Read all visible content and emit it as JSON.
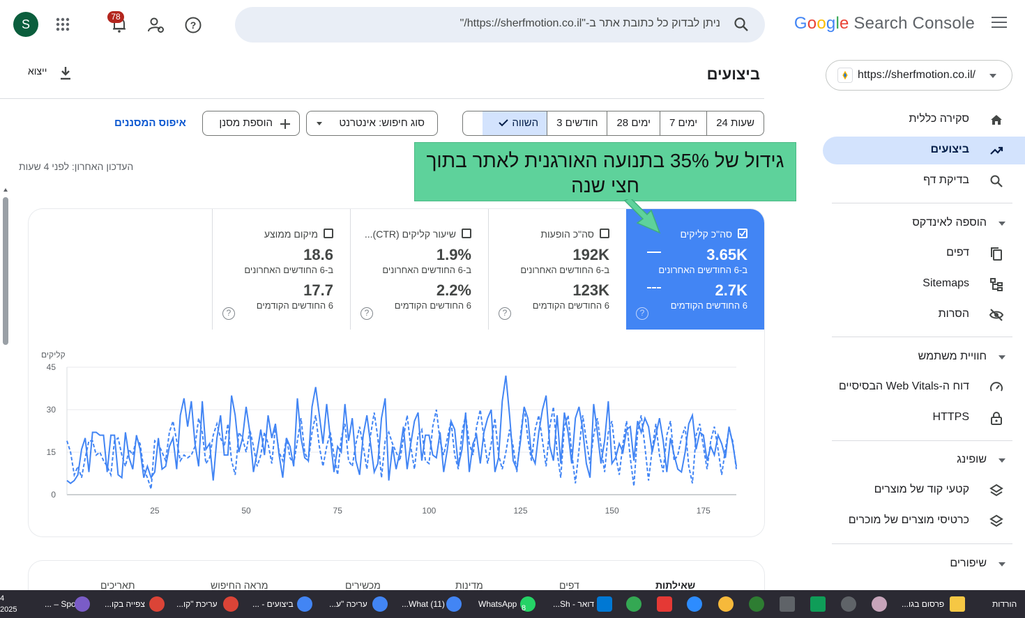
{
  "header": {
    "logo_google": "Google",
    "logo_rest": "Search Console",
    "search_placeholder": "ניתן לבדוק כל כתובת אתר ב-\"https://sherfmotion.co.il/\"",
    "avatar_letter": "S",
    "notification_count": "78"
  },
  "sidebar": {
    "property_url": "https://sherfmotion.co.il/",
    "items": [
      {
        "label": "סקירה כללית",
        "icon": "home-icon"
      },
      {
        "label": "ביצועים",
        "icon": "trending-up-icon",
        "active": true
      },
      {
        "label": "בדיקת דף",
        "icon": "search-icon"
      }
    ],
    "sections": [
      {
        "label": "הוספה לאינדקס",
        "items": [
          {
            "label": "דפים",
            "icon": "pages-icon"
          },
          {
            "label": "Sitemaps",
            "icon": "sitemap-icon"
          },
          {
            "label": "הסרות",
            "icon": "visibility-off-icon"
          }
        ]
      },
      {
        "label": "חוויית משתמש",
        "items": [
          {
            "label": "דוח ה-Web Vitals הבסיסיים",
            "icon": "speed-icon"
          },
          {
            "label": "HTTPS",
            "icon": "lock-icon"
          }
        ]
      },
      {
        "label": "שופינג",
        "items": [
          {
            "label": "קטעי קוד של מוצרים",
            "icon": "layers-icon"
          },
          {
            "label": "כרטיסי מוצרים של מוכרים",
            "icon": "layers-icon"
          }
        ]
      },
      {
        "label": "שיפורים",
        "items": []
      }
    ]
  },
  "main": {
    "title": "ביצועים",
    "export_label": "ייצוא",
    "date_ranges": [
      "24 שעות",
      "7 ימים",
      "28 ימים",
      "3 חודשים",
      "השווה"
    ],
    "date_range_selected": "השווה",
    "search_type_chip": "סוג חיפוש: אינטרנט",
    "add_filter_label": "הוספת מסנן",
    "reset_filters_label": "איפוס המסננים",
    "last_updated": "העדכון האחרון: לפני 4 שעות",
    "annotation": "גידול של 35% בתנועה האורגנית לאתר בתוך חצי שנה",
    "metrics": [
      {
        "label": "סה\"כ קליקים",
        "checked": true,
        "value_current": "3.65K",
        "label_current": "ב-6 החודשים האחרונים",
        "value_previous": "2.7K",
        "label_previous": "6 החודשים הקודמים",
        "color": "#4285f4"
      },
      {
        "label": "סה\"כ הופעות",
        "checked": false,
        "value_current": "192K",
        "label_current": "ב-6 החודשים האחרונים",
        "value_previous": "123K",
        "label_previous": "6 החודשים הקודמים"
      },
      {
        "label": "שיעור קליקים (CTR)...",
        "checked": false,
        "value_current": "1.9%",
        "label_current": "ב-6 החודשים האחרונים",
        "value_previous": "2.2%",
        "label_previous": "6 החודשים הקודמים"
      },
      {
        "label": "מיקום ממוצע",
        "checked": false,
        "value_current": "18.6",
        "label_current": "ב-6 החודשים האחרונים",
        "value_previous": "17.7",
        "label_previous": "6 החודשים הקודמים"
      }
    ],
    "bottom_tabs": [
      "שאילתות",
      "דפים",
      "מדינות",
      "מכשירים",
      "מראה החיפוש",
      "תאריכים"
    ]
  },
  "chart_data": {
    "type": "line",
    "ylabel": "קליקים",
    "ylim": [
      0,
      45
    ],
    "yticks": [
      0,
      15,
      30,
      45
    ],
    "xlim": [
      1,
      184
    ],
    "xticks": [
      25,
      50,
      75,
      100,
      125,
      150,
      175
    ],
    "grid": true,
    "color": "#4285f4",
    "series": [
      {
        "style": "solid",
        "values": [
          5,
          4,
          5,
          7,
          16,
          20,
          8,
          22,
          22,
          21,
          21,
          8,
          21,
          21,
          7,
          6,
          22,
          13,
          9,
          21,
          16,
          6,
          10,
          6,
          8,
          20,
          9,
          10,
          17,
          20,
          9,
          28,
          34,
          24,
          33,
          18,
          10,
          33,
          16,
          18,
          5,
          20,
          28,
          14,
          14,
          35,
          28,
          15,
          20,
          31,
          22,
          8,
          15,
          23,
          14,
          28,
          20,
          25,
          14,
          6,
          20,
          17,
          10,
          34,
          20,
          13,
          12,
          31,
          38,
          28,
          18,
          32,
          20,
          8,
          17,
          15,
          32,
          19,
          27,
          12,
          7,
          21,
          28,
          18,
          8,
          11,
          27,
          34,
          5,
          17,
          9,
          15,
          24,
          9,
          18,
          26,
          29,
          12,
          21,
          21,
          14,
          13,
          22,
          8,
          16,
          26,
          23,
          10,
          16,
          29,
          8,
          18,
          21,
          11,
          22,
          27,
          30,
          8,
          13,
          33,
          42,
          28,
          12,
          9,
          19,
          31,
          27,
          14,
          11,
          22,
          30,
          35,
          17,
          12,
          28,
          11,
          29,
          22,
          11,
          27,
          31,
          23,
          11,
          6,
          32,
          22,
          11,
          19,
          33,
          11,
          13,
          18,
          15,
          23,
          24,
          12,
          26,
          22,
          27,
          24,
          15,
          21,
          27,
          19,
          8,
          20,
          14,
          9,
          8,
          15,
          25,
          28,
          16,
          22,
          21,
          12,
          17,
          14,
          21,
          18,
          13,
          24,
          18,
          10
        ]
      },
      {
        "style": "dashed",
        "values": [
          19,
          15,
          7,
          10,
          6,
          13,
          19,
          19,
          14,
          15,
          12,
          10,
          7,
          19,
          20,
          14,
          10,
          16,
          14,
          20,
          18,
          9,
          6,
          2,
          19,
          18,
          15,
          12,
          22,
          26,
          19,
          12,
          14,
          13,
          14,
          17,
          27,
          22,
          11,
          13,
          21,
          25,
          20,
          17,
          25,
          12,
          7,
          22,
          20,
          15,
          23,
          17,
          10,
          14,
          22,
          18,
          11,
          24,
          15,
          12,
          20,
          13,
          11,
          19,
          27,
          15,
          12,
          22,
          28,
          17,
          10,
          17,
          22,
          14,
          7,
          20,
          25,
          12,
          10,
          18,
          24,
          17,
          9,
          21,
          29,
          20,
          6,
          19,
          22,
          18,
          15,
          12,
          20,
          28,
          17,
          9,
          21,
          23,
          12,
          11,
          24,
          30,
          19,
          14,
          20,
          26,
          14,
          9,
          22,
          28,
          18,
          14,
          24,
          30,
          20,
          11,
          18,
          27,
          14,
          9,
          15,
          23,
          17,
          8,
          21,
          31,
          20,
          12,
          23,
          28,
          19,
          10,
          24,
          31,
          15,
          6,
          24,
          28,
          15,
          4,
          16,
          28,
          19,
          11,
          21,
          27,
          17,
          8,
          22,
          26,
          14,
          7,
          18,
          26,
          13,
          3,
          22,
          28,
          17,
          5,
          16,
          25,
          14,
          8,
          21,
          26,
          12,
          14,
          20,
          24,
          10,
          4,
          21,
          25,
          17,
          9,
          19,
          24,
          16,
          7,
          16,
          23,
          19,
          9
        ]
      }
    ]
  },
  "taskbar": {
    "clock_line1": "4",
    "clock_line2": "2025",
    "items": [
      "הורדות",
      "פרסום בגו...",
      "WhatsApp",
      "(11) What...",
      "עריכה \"ע...",
      "ביצועים - ...",
      "עריכת \"קו...",
      "צפייה בקו...",
      "Spotify – ...",
      "דואר - Sh..."
    ],
    "whatsapp_badge": "8"
  }
}
